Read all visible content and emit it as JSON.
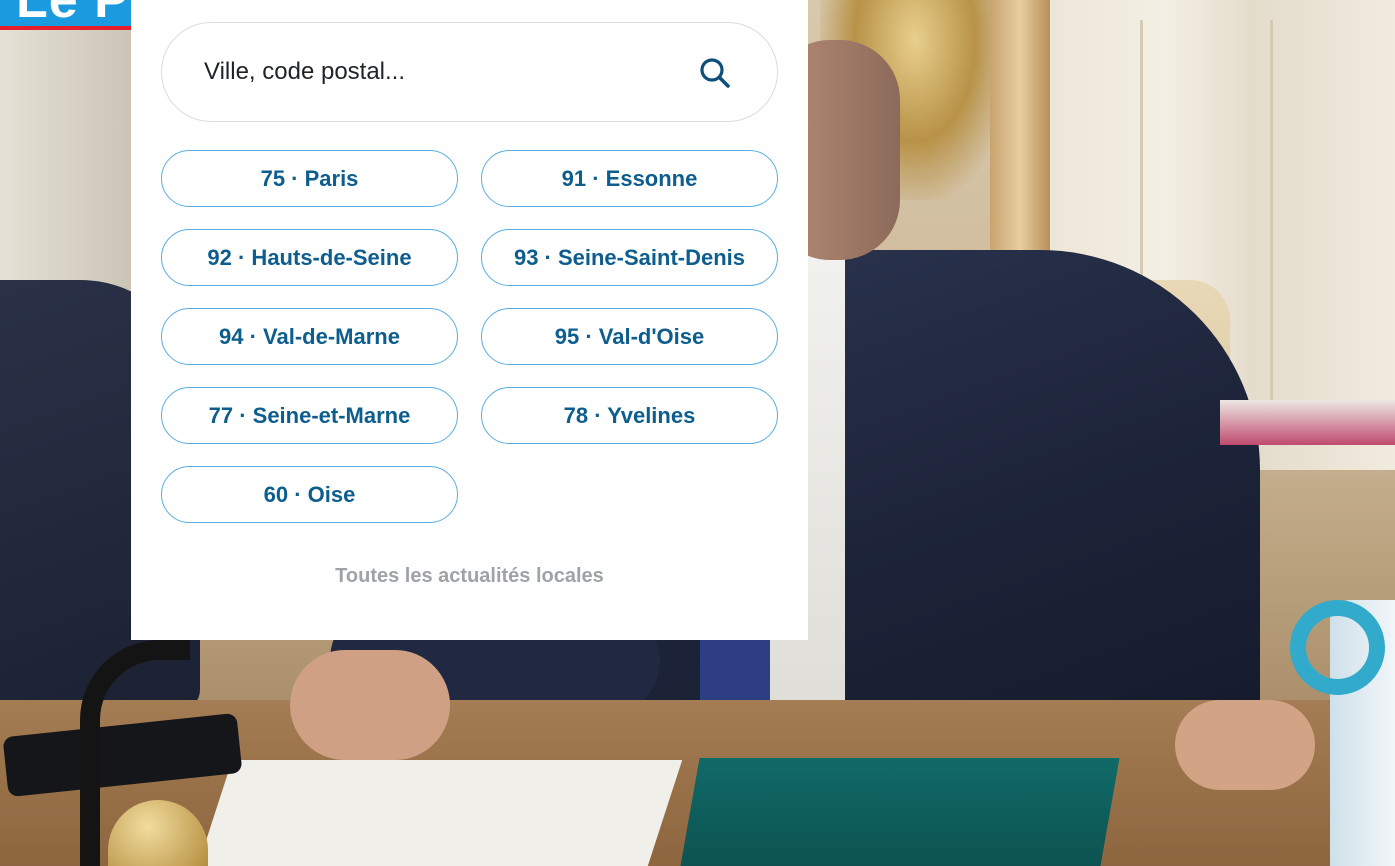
{
  "logo": {
    "text": "Le Parisien",
    "accent": "#1b9ae0",
    "underline": "#e51e2a"
  },
  "search": {
    "placeholder": "Ville, code postal...",
    "icon": "search-icon"
  },
  "departments": [
    {
      "label": "75 · Paris"
    },
    {
      "label": "91 · Essonne"
    },
    {
      "label": "92 · Hauts-de-Seine"
    },
    {
      "label": "93 · Seine-Saint-Denis"
    },
    {
      "label": "94 · Val-de-Marne"
    },
    {
      "label": "95 · Val-d'Oise"
    },
    {
      "label": "77 · Seine-et-Marne"
    },
    {
      "label": "78 · Yvelines"
    },
    {
      "label": "60 · Oise"
    }
  ],
  "footer_link": "Toutes les actualités locales",
  "colors": {
    "button_border": "#5aaee0",
    "button_text": "#0d5e8e",
    "muted_link": "#9ea3a8"
  }
}
